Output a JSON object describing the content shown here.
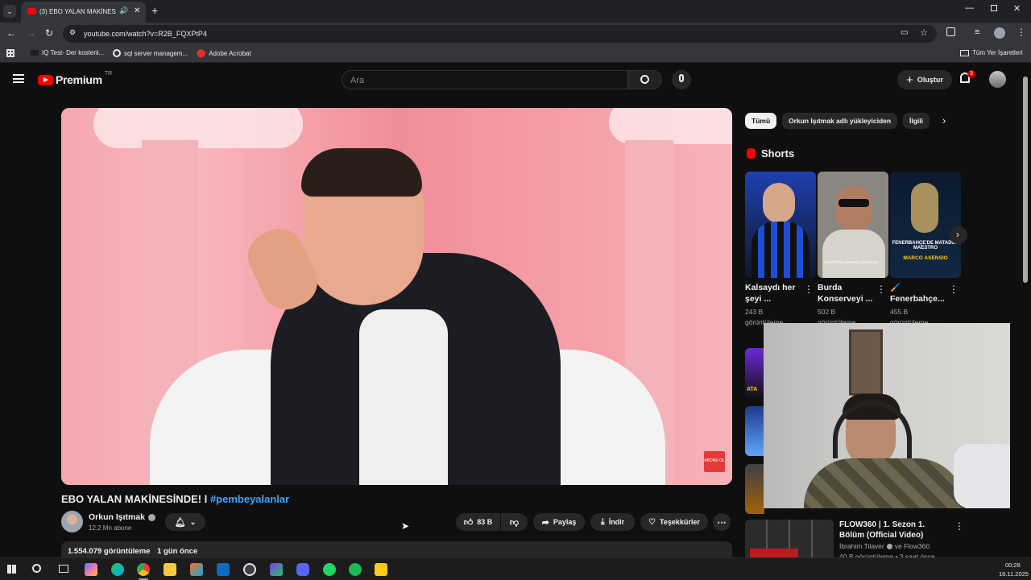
{
  "browser": {
    "tab_title": "(3) EBO YALAN MAKİNESİNDE",
    "url": "youtube.com/watch?v=R2B_FQXPtP4",
    "bookmarks": [
      {
        "label": "IQ Test- Der kostenl..."
      },
      {
        "label": "sql server managem..."
      },
      {
        "label": "Adobe Acrobat"
      }
    ],
    "all_bookmarks": "Tüm Yer İşaretleri"
  },
  "youtube": {
    "logo_text": "Premium",
    "region": "TR",
    "search_placeholder": "Ara",
    "create_label": "Oluştur",
    "notif_count": "3",
    "video": {
      "title": "EBO YALAN MAKİNESİNDE! l",
      "hashtag": "#pembeyalanlar",
      "channel": "Orkun Işıtmak",
      "subscribers": "12,2 Mn abone",
      "likes": "83 B",
      "share": "Paylaş",
      "download": "İndir",
      "thanks": "Teşekkürler",
      "views": "1.554.079 görüntüleme",
      "age": "1 gün önce",
      "watermark": "ABONE OL"
    },
    "chips": [
      "Tümü",
      "Orkun Işıtmak adlı yükleyiciden",
      "İlgili"
    ],
    "shorts_heading": "Shorts",
    "shorts": [
      {
        "title": "Kalsaydı her şeyi ...",
        "views": "243 B",
        "unit": "görüntüleme"
      },
      {
        "title": "Burda Konserveyi ...",
        "views": "502 B",
        "unit": "görüntüleme"
      },
      {
        "title": "🖌️ Fenerbahçe...",
        "views": "455 B",
        "unit": "görüntüleme"
      }
    ],
    "short_overlays": [
      "FENERBAHÇE'DE MATADOR MAESTRO",
      "MARCO ASENSIO",
      "BAK 87'DE KABURGA DOLMASI...",
      "ATA"
    ],
    "rec": {
      "title": "FLOW360 | 1. Sezon 1. Bölüm (Official Video)",
      "channel": "İbrahim Tilaver",
      "channel_suffix": "ve Flow360",
      "meta": "40 B görüntüleme • 3 saat önce"
    }
  },
  "taskbar": {
    "time": "00:28",
    "date": "16.11.2025"
  }
}
